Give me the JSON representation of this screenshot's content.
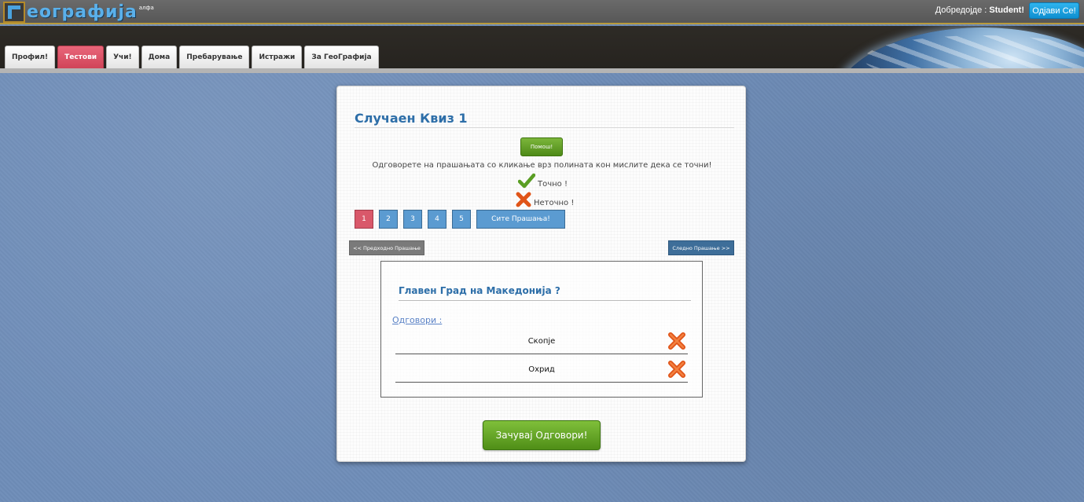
{
  "app": {
    "logo_text": "еографија",
    "logo_sup": "алфа",
    "welcome_prefix": "Добредојде : ",
    "username": "Student!",
    "logout_label": "Одјави Се!"
  },
  "tabs": [
    {
      "label": "Профил!",
      "active": false
    },
    {
      "label": "Тестови",
      "active": true
    },
    {
      "label": "Учи!",
      "active": false
    },
    {
      "label": "Дома",
      "active": false
    },
    {
      "label": "Пребарување",
      "active": false
    },
    {
      "label": "Истражи",
      "active": false
    },
    {
      "label": "За ГеоГрафија",
      "active": false
    }
  ],
  "quiz": {
    "title": "Случаен Квиз 1",
    "help_label": "Помош!",
    "instructions": "Одговорете на прашањата со кликање врз полината кон мислите дека се точни!",
    "legend_correct": "Точно !",
    "legend_wrong": "Неточно !",
    "question_numbers": [
      "1",
      "2",
      "3",
      "4",
      "5"
    ],
    "all_questions_label": "Сите Прашања!",
    "prev_label": "<< Предходно Прашање",
    "next_label": "Следно Прашање >>",
    "question": "Главен Град на Македонија ?",
    "answers_label": "Одговори :",
    "answers": [
      {
        "text": "Скопје",
        "icon": "x-icon"
      },
      {
        "text": "Охрид",
        "icon": "x-icon"
      }
    ],
    "save_label": "Зачувај Одговори!"
  },
  "colors": {
    "accent_blue": "#2d6ea8",
    "tab_active": "#d04458",
    "green_button": "#4f8e17",
    "nav_blue": "#5b9bd1"
  }
}
